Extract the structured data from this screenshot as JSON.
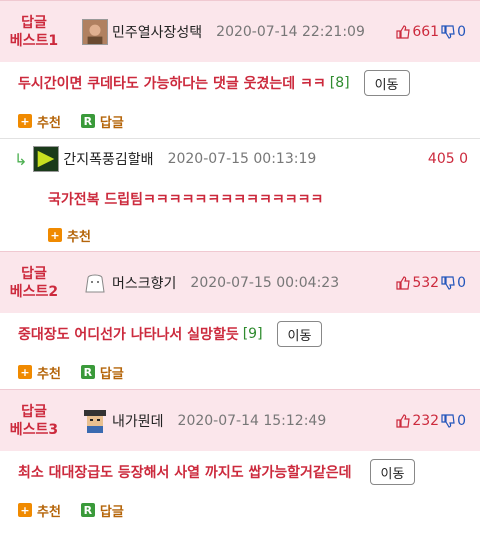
{
  "colors": {
    "best_bg": "#fbe6eb",
    "accent_red": "#cc2a3d",
    "down_blue": "#2255bb",
    "orange": "#f08a00",
    "green": "#3a9a3a"
  },
  "icons": {
    "recommend": "plus-square-icon",
    "reply": "r-square-icon",
    "thumb_up": "thumb-up-icon",
    "thumb_down": "thumb-down-icon",
    "reply_arrow": "reply-arrow-icon"
  },
  "comments": [
    {
      "badge_top": "답글",
      "badge_bottom": "베스트1",
      "nickname": "민주열사장성택",
      "date": "2020-07-14 22:21:09",
      "upvotes": "661",
      "downvotes": "0",
      "text": "두시간이면 쿠데타도 가능하다는 댓글 웃겼는데 ㅋㅋ",
      "count": "[8]",
      "move_label": "이동",
      "recommend_label": "추천",
      "reply_label": "답글"
    },
    {
      "badge_top": "답글",
      "badge_bottom": "베스트2",
      "nickname": "머스크향기",
      "date": "2020-07-15 00:04:23",
      "upvotes": "532",
      "downvotes": "0",
      "text": "중대장도 어디선가 나타나서 실망할듯",
      "count": "[9]",
      "move_label": "이동",
      "recommend_label": "추천",
      "reply_label": "답글"
    },
    {
      "badge_top": "답글",
      "badge_bottom": "베스트3",
      "nickname": "내가뭔데",
      "date": "2020-07-14 15:12:49",
      "upvotes": "232",
      "downvotes": "0",
      "text": "최소 대대장급도 등장해서 사열 까지도 쌉가능할거같은데",
      "count": "",
      "move_label": "이동",
      "recommend_label": "추천",
      "reply_label": "답글"
    }
  ],
  "reply": {
    "nickname": "간지폭풍김할배",
    "date": "2020-07-15 00:13:19",
    "votes": "405 0",
    "text": "국가전복 드립팀ㅋㅋㅋㅋㅋㅋㅋㅋㅋㅋㅋㅋㅋㅋ",
    "recommend_label": "추천"
  }
}
